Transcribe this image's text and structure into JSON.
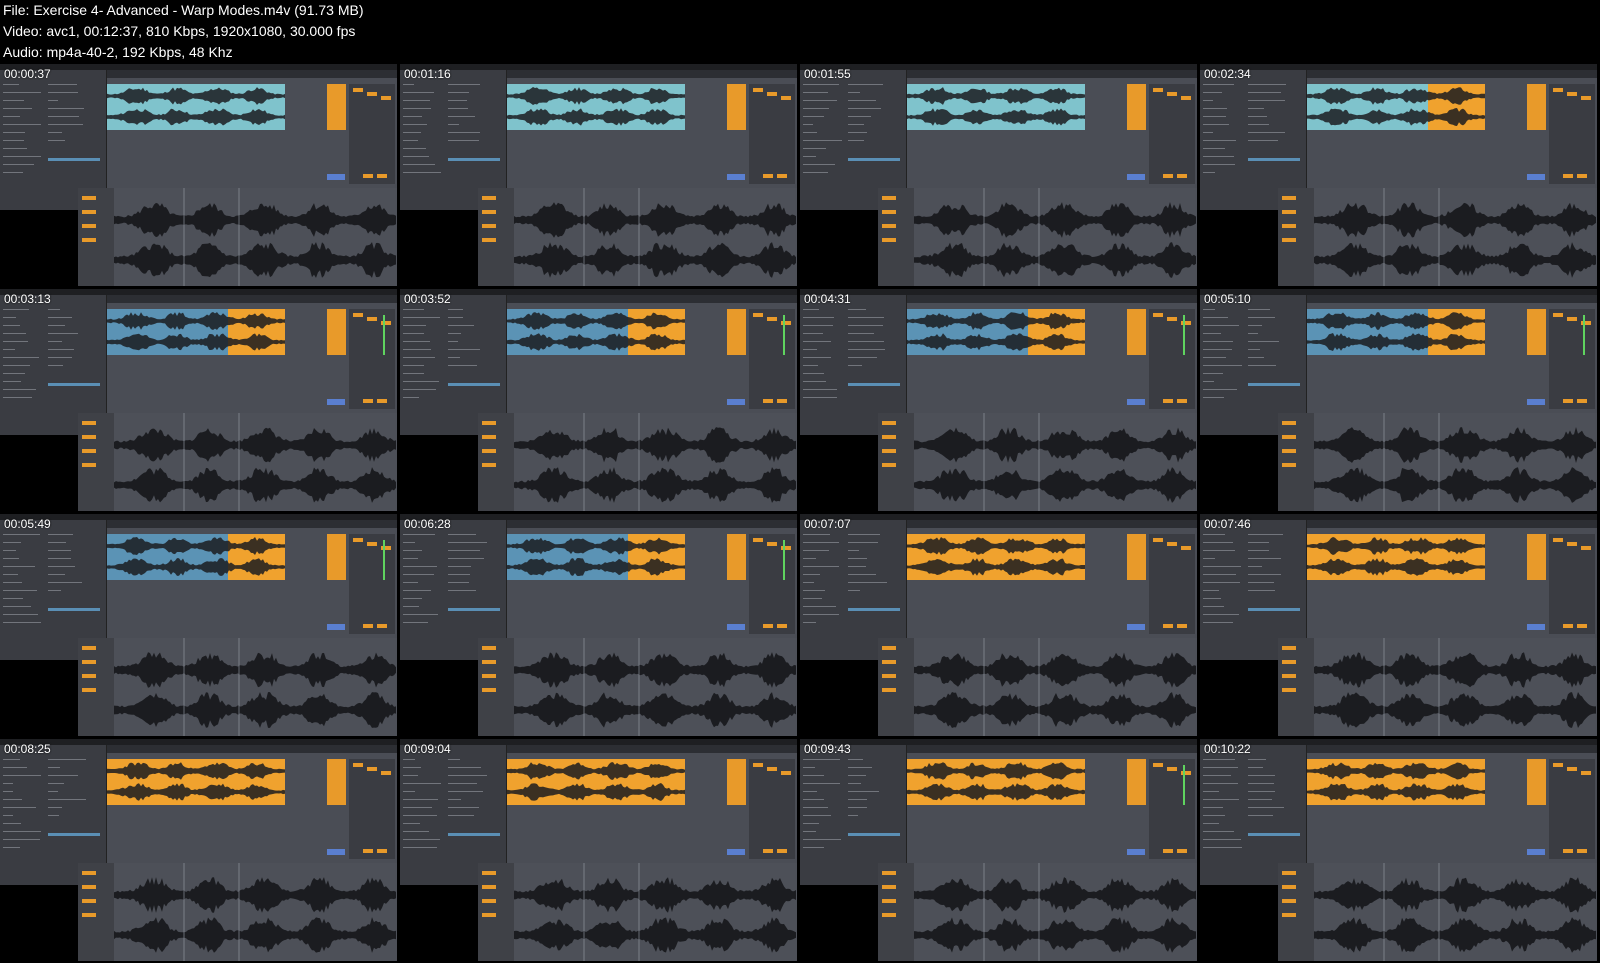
{
  "header": {
    "file_line": "File: Exercise 4- Advanced - Warp Modes.m4v (91.73 MB)",
    "video_line": "Video: avc1, 00:12:37, 810 Kbps, 1920x1080, 30.000 fps",
    "audio_line": "Audio: mp4a-40-2, 192 Kbps, 48 Khz"
  },
  "colors": {
    "clip_blue": "#7fc3cc",
    "clip_steel": "#5b93b5",
    "clip_orange": "#f0a22e",
    "panel_bg": "#3a3c42",
    "arrange_bg": "#4a4d55",
    "waveform_dark": "#1b1c20"
  },
  "thumbnails": [
    {
      "timestamp": "00:00:37",
      "clip_style": "blue"
    },
    {
      "timestamp": "00:01:16",
      "clip_style": "blue"
    },
    {
      "timestamp": "00:01:55",
      "clip_style": "blue"
    },
    {
      "timestamp": "00:02:34",
      "clip_style": "blue_orange"
    },
    {
      "timestamp": "00:03:13",
      "clip_style": "steel_orange"
    },
    {
      "timestamp": "00:03:52",
      "clip_style": "steel_orange"
    },
    {
      "timestamp": "00:04:31",
      "clip_style": "steel_orange"
    },
    {
      "timestamp": "00:05:10",
      "clip_style": "steel_orange"
    },
    {
      "timestamp": "00:05:49",
      "clip_style": "steel_orange"
    },
    {
      "timestamp": "00:06:28",
      "clip_style": "steel_orange"
    },
    {
      "timestamp": "00:07:07",
      "clip_style": "orange"
    },
    {
      "timestamp": "00:07:46",
      "clip_style": "orange"
    },
    {
      "timestamp": "00:08:25",
      "clip_style": "orange"
    },
    {
      "timestamp": "00:09:04",
      "clip_style": "orange"
    },
    {
      "timestamp": "00:09:43",
      "clip_style": "orange"
    },
    {
      "timestamp": "00:10:22",
      "clip_style": "orange"
    }
  ]
}
